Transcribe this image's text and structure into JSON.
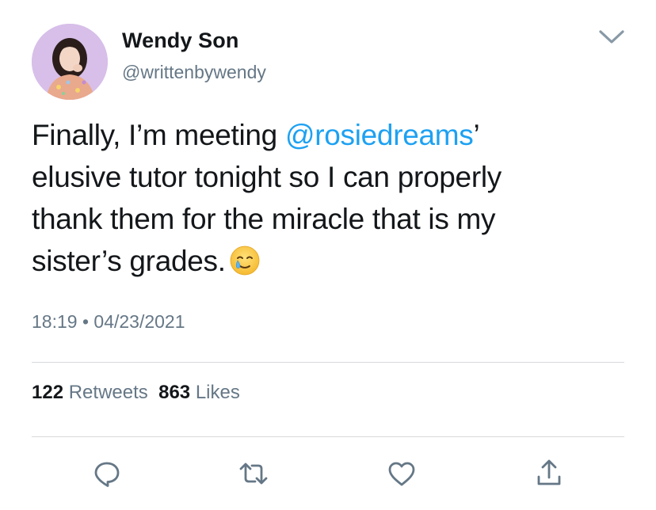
{
  "user": {
    "name": "Wendy Son",
    "handle": "@writtenbywendy"
  },
  "tweet": {
    "line1_before": "Finally, I’m meeting ",
    "mention": "@rosiedreams",
    "line1_after": "’",
    "line2": "elusive tutor tonight so I can properly",
    "line3": "thank them for the miracle that is my",
    "line4": "sister’s grades.",
    "emoji": "smiling-face-with-tear-icon"
  },
  "meta": {
    "time": "18:19",
    "separator": "•",
    "date": "04/23/2021"
  },
  "stats": {
    "retweets_count": "122",
    "retweets_label": "Retweets",
    "likes_count": "863",
    "likes_label": "Likes"
  },
  "actions": [
    "reply-icon",
    "retweet-icon",
    "like-icon",
    "share-icon"
  ],
  "colors": {
    "accent": "#1da1f2",
    "text": "#14171a",
    "secondary": "#657786",
    "divider": "#d6d9dc",
    "icon": "#657786"
  }
}
